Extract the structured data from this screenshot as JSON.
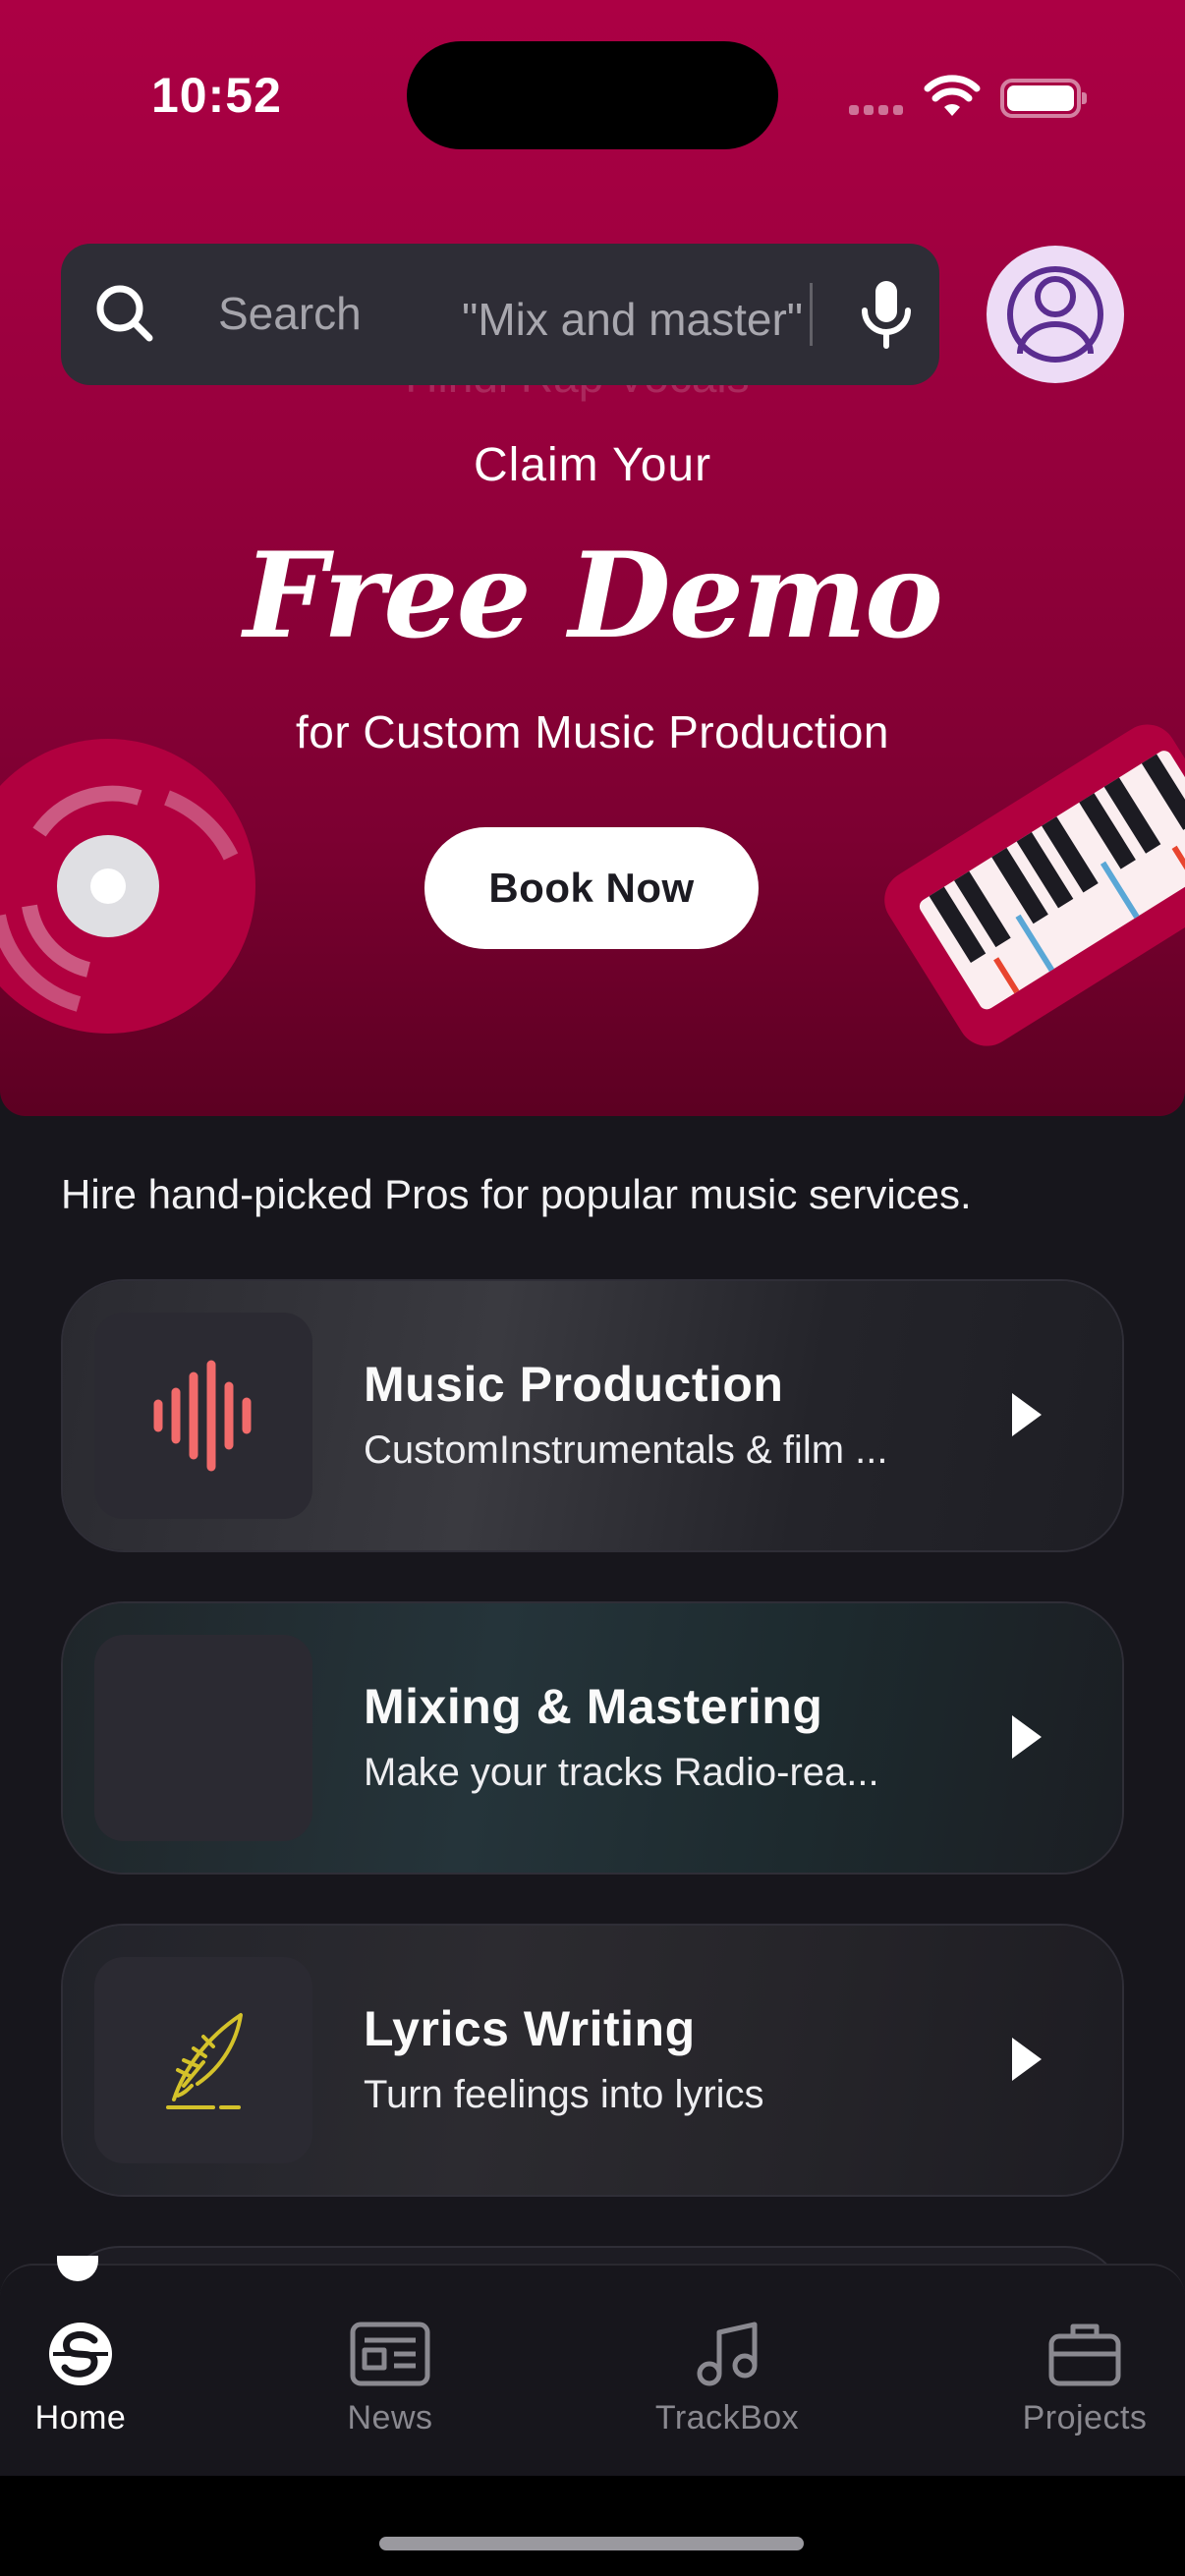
{
  "status_bar": {
    "time": "10:52"
  },
  "search": {
    "label": "Search",
    "hint_current": "\"Mix and master\"",
    "hint_next": "\"Hindi Rap Vocals\""
  },
  "hero": {
    "line1": "Claim Your",
    "headline": "Free Demo",
    "line3": "for Custom Music Production",
    "cta_label": "Book Now",
    "colors": {
      "top": "#ac0044",
      "bottom": "#5c0022"
    }
  },
  "intro_text": "Hire hand-picked Pros for popular music services.",
  "services": [
    {
      "title": "Music Production",
      "subtitle": "CustomInstrumentals & film ...",
      "icon": "sound-wave-icon",
      "accent": "#f26b6b"
    },
    {
      "title": "Mixing & Mastering",
      "subtitle": "Make your tracks Radio-rea...",
      "icon": "equalizer-bars-icon",
      "accent": "#1fb3a6"
    },
    {
      "title": "Lyrics Writing",
      "subtitle": "Turn feelings into lyrics",
      "icon": "quill-icon",
      "accent": "#d4c22a"
    }
  ],
  "nav": {
    "items": [
      {
        "label": "Home",
        "icon": "home-logo-icon",
        "active": true
      },
      {
        "label": "News",
        "icon": "newspaper-icon",
        "active": false
      },
      {
        "label": "TrackBox",
        "icon": "music-note-icon",
        "active": false
      },
      {
        "label": "Projects",
        "icon": "briefcase-icon",
        "active": false
      }
    ]
  }
}
